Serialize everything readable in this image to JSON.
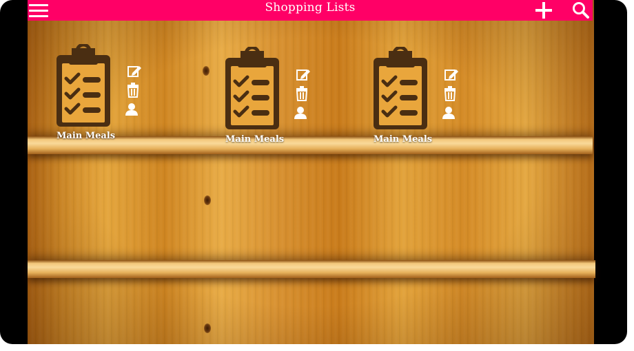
{
  "appbar": {
    "title": "Shopping Lists",
    "background_color": "#ff0066",
    "icons": [
      "hamburger-menu-icon",
      "plus-icon",
      "search-icon"
    ]
  },
  "lists": [
    {
      "name": "Main Meals",
      "icon": "clipboard-checklist-icon",
      "actions": [
        "edit-icon",
        "trash-icon",
        "user-icon"
      ]
    },
    {
      "name": "Main Meals",
      "icon": "clipboard-checklist-icon",
      "actions": [
        "edit-icon",
        "trash-icon",
        "user-icon"
      ]
    },
    {
      "name": "Main Meals",
      "icon": "clipboard-checklist-icon",
      "actions": [
        "edit-icon",
        "trash-icon",
        "user-icon"
      ]
    }
  ],
  "colors": {
    "accent": "#ff0066",
    "clipboard_dark": "#4a2e12",
    "clipboard_light": "#e9a63c"
  }
}
